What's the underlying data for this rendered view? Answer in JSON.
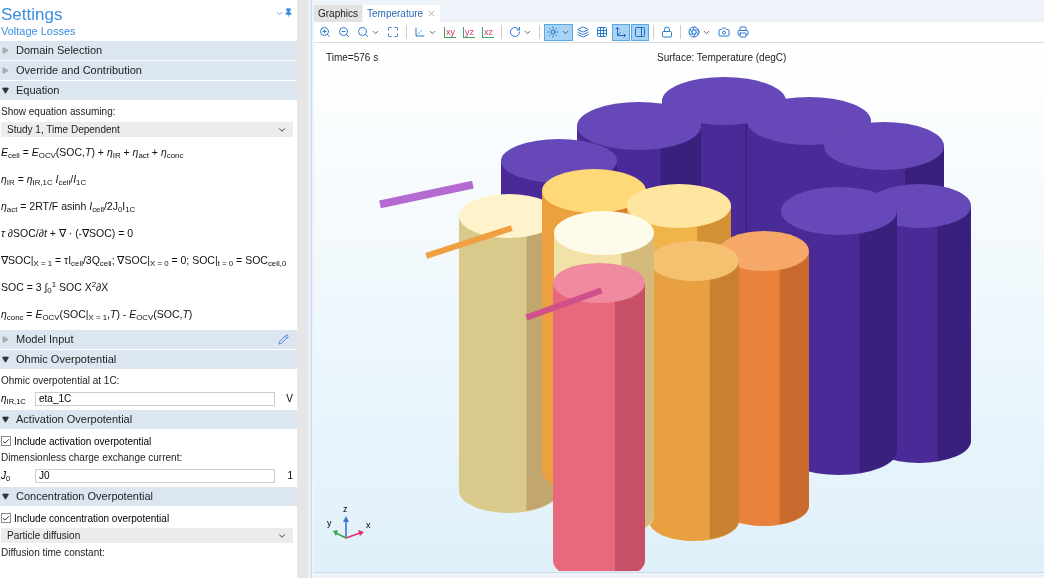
{
  "settings": {
    "title": "Settings",
    "subtitle": "Voltage Losses",
    "sections": [
      {
        "title": "Domain Selection",
        "expanded": false,
        "edit_icon": false
      },
      {
        "title": "Override and Contribution",
        "expanded": false,
        "edit_icon": false
      },
      {
        "title": "Equation",
        "expanded": true,
        "edit_icon": false,
        "content": [
          {
            "kind": "label",
            "text": "Show equation assuming:"
          },
          {
            "kind": "select",
            "value": "Study 1, Time Dependent"
          },
          {
            "kind": "equation",
            "text": "*E*$_{cell}$ = *E*$_{OCV}$(SOC,*T*) + *η*$_{IR}$ + *η*$_{act}$ + *η*$_{conc}$"
          },
          {
            "kind": "equation",
            "text": "*η*$_{IR}$ = *η*$_{IR,1C}$ *I*$_{cell}$/*I*$_{1C}$"
          },
          {
            "kind": "equation",
            "text": "*η*$_{act}$ = 2RT/F asinh *I*$_{cell}$/2J$_{0}$I$_{1C}$"
          },
          {
            "kind": "equation",
            "text": "*τ* ∂SOC/∂*t* + ∇ · (-∇SOC) = 0"
          },
          {
            "kind": "equation",
            "text": "∇SOC|$_{X = 1}$ = τI$_{cell}$/3Q$_{cell}$;  ∇SOC|$_{X = 0}$ = 0;  SOC|$_{t = 0}$ = SOC$_{cell,0}$"
          },
          {
            "kind": "equation",
            "text": "SOC = 3 ∫$_{0}$$^{1}$ SOC X$^{2}$∂X"
          },
          {
            "kind": "equation",
            "text": "*η*$_{conc}$ = *E*$_{OCV}$(SOC|$_{X = 1}$,*T*) - *E*$_{OCV}$(SOC,*T*)"
          }
        ]
      },
      {
        "title": "Model Input",
        "expanded": false,
        "edit_icon": true
      },
      {
        "title": "Ohmic Overpotential",
        "expanded": true,
        "edit_icon": false,
        "content": [
          {
            "kind": "label",
            "text": "Ohmic overpotential at 1C:"
          },
          {
            "kind": "field",
            "symbol": "*η*$_{IR,1C}$",
            "value": "eta_1C",
            "unit": "V"
          }
        ]
      },
      {
        "title": "Activation Overpotential",
        "expanded": true,
        "edit_icon": false,
        "content": [
          {
            "kind": "checkbox",
            "text": "Include activation overpotential",
            "checked": true
          },
          {
            "kind": "label",
            "text": "Dimensionless charge exchange current:"
          },
          {
            "kind": "field",
            "symbol": "*J*$_{0}$",
            "value": "J0",
            "unit": "1"
          }
        ]
      },
      {
        "title": "Concentration Overpotential",
        "expanded": true,
        "edit_icon": false,
        "content": [
          {
            "kind": "checkbox",
            "text": "Include concentration overpotential",
            "checked": true
          },
          {
            "kind": "select",
            "value": "Particle diffusion"
          },
          {
            "kind": "label",
            "text": "Diffusion time constant:"
          }
        ]
      }
    ]
  },
  "graphics": {
    "tabs": [
      {
        "label": "Graphics",
        "selected": false,
        "closable": false
      },
      {
        "label": "Temperature",
        "selected": true,
        "closable": true
      }
    ],
    "toolbar": [
      {
        "kind": "zoom-in",
        "pressed": false,
        "dropdown": false
      },
      {
        "kind": "zoom-out",
        "pressed": false,
        "dropdown": false
      },
      {
        "kind": "zoom-box",
        "pressed": false,
        "dropdown": true
      },
      {
        "kind": "zoom-extents",
        "pressed": false,
        "dropdown": false
      },
      {
        "kind": "separator"
      },
      {
        "kind": "axes",
        "pressed": false,
        "dropdown": true
      },
      {
        "kind": "view",
        "label": "xy",
        "pressed": false,
        "dropdown": false
      },
      {
        "kind": "view",
        "label": "yz",
        "pressed": false,
        "dropdown": false
      },
      {
        "kind": "view",
        "label": "xz",
        "pressed": false,
        "dropdown": false
      },
      {
        "kind": "separator"
      },
      {
        "kind": "rotate",
        "pressed": false,
        "dropdown": true
      },
      {
        "kind": "separator"
      },
      {
        "kind": "light",
        "pressed": true,
        "dropdown": true
      },
      {
        "kind": "transparency",
        "pressed": false,
        "dropdown": false
      },
      {
        "kind": "grid",
        "pressed": false,
        "dropdown": false
      },
      {
        "kind": "orientation",
        "pressed": true,
        "dropdown": false
      },
      {
        "kind": "legend",
        "pressed": true,
        "dropdown": false
      },
      {
        "kind": "separator"
      },
      {
        "kind": "lock",
        "pressed": false,
        "dropdown": false
      },
      {
        "kind": "separator"
      },
      {
        "kind": "scene",
        "pressed": false,
        "dropdown": true
      },
      {
        "kind": "camera",
        "pressed": false,
        "dropdown": false
      },
      {
        "kind": "print",
        "pressed": false,
        "dropdown": false
      }
    ],
    "time_label": "Time=576 s",
    "plot_title": "Surface: Temperature (degC)",
    "axes": {
      "x": "x",
      "y": "y",
      "z": "z"
    }
  }
}
